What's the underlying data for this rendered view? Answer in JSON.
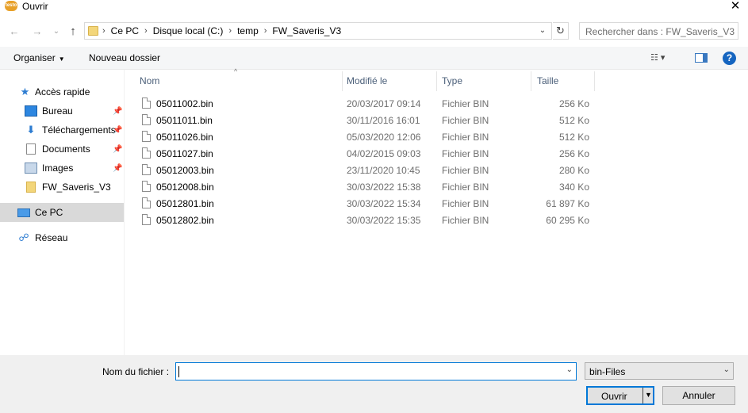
{
  "window": {
    "title": "Ouvrir",
    "app_icon_text": "testo",
    "close_glyph": "✕"
  },
  "address_bar": {
    "back_glyph": "←",
    "forward_glyph": "→",
    "recent_glyph": "⌄",
    "up_glyph": "↑",
    "breadcrumbs": [
      "Ce PC",
      "Disque local (C:)",
      "temp",
      "FW_Saveris_V3"
    ],
    "separator": "›",
    "dropdown_glyph": "⌄",
    "refresh_glyph": "↻",
    "search_placeholder": "Rechercher dans : FW_Saveris_V3"
  },
  "toolbar": {
    "organise_label": "Organiser",
    "caret": "▼",
    "new_folder_label": "Nouveau dossier",
    "view_glyph": "☷ ▾",
    "help_glyph": "?"
  },
  "nav_pane": {
    "items": [
      {
        "label": "Accès rapide",
        "icon": "star-icon",
        "glyph": "★",
        "pinned": false
      },
      {
        "label": "Bureau",
        "icon": "desktop-icon",
        "glyph": "",
        "pinned": true
      },
      {
        "label": "Téléchargements",
        "icon": "download-icon",
        "glyph": "⬇",
        "pinned": true
      },
      {
        "label": "Documents",
        "icon": "document-icon",
        "glyph": "",
        "pinned": true
      },
      {
        "label": "Images",
        "icon": "image-icon",
        "glyph": "",
        "pinned": true
      },
      {
        "label": "FW_Saveris_V3",
        "icon": "folder-icon",
        "glyph": "",
        "pinned": false
      },
      {
        "label": "Ce PC",
        "icon": "computer-icon",
        "glyph": "",
        "pinned": false,
        "selected": true
      },
      {
        "label": "Réseau",
        "icon": "network-icon",
        "glyph": "☍",
        "pinned": false
      }
    ],
    "pin_glyph": "📌"
  },
  "file_list": {
    "sort_glyph": "^",
    "columns": {
      "name": "Nom",
      "modified": "Modifié le",
      "type": "Type",
      "size": "Taille"
    },
    "rows": [
      {
        "name": "05011002.bin",
        "modified": "20/03/2017 09:14",
        "type": "Fichier BIN",
        "size": "256 Ko"
      },
      {
        "name": "05011011.bin",
        "modified": "30/11/2016 16:01",
        "type": "Fichier BIN",
        "size": "512 Ko"
      },
      {
        "name": "05011026.bin",
        "modified": "05/03/2020 12:06",
        "type": "Fichier BIN",
        "size": "512 Ko"
      },
      {
        "name": "05011027.bin",
        "modified": "04/02/2015 09:03",
        "type": "Fichier BIN",
        "size": "256 Ko"
      },
      {
        "name": "05012003.bin",
        "modified": "23/11/2020 10:45",
        "type": "Fichier BIN",
        "size": "280 Ko"
      },
      {
        "name": "05012008.bin",
        "modified": "30/03/2022 15:38",
        "type": "Fichier BIN",
        "size": "340 Ko"
      },
      {
        "name": "05012801.bin",
        "modified": "30/03/2022 15:34",
        "type": "Fichier BIN",
        "size": "61 897 Ko"
      },
      {
        "name": "05012802.bin",
        "modified": "30/03/2022 15:35",
        "type": "Fichier BIN",
        "size": "60 295 Ko"
      }
    ]
  },
  "bottom": {
    "filename_label": "Nom du fichier :",
    "filename_value": "",
    "dropdown_glyph": "⌄",
    "filter_value": "bin-Files",
    "open_label": "Ouvrir",
    "open_dd_glyph": "▼",
    "cancel_label": "Annuler"
  }
}
